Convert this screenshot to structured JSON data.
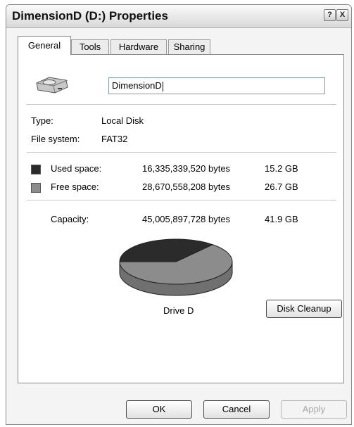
{
  "window": {
    "title": "DimensionD (D:) Properties",
    "help_glyph": "?",
    "close_glyph": "X"
  },
  "tabs": [
    {
      "label": "General",
      "active": true
    },
    {
      "label": "Tools",
      "active": false
    },
    {
      "label": "Hardware",
      "active": false
    },
    {
      "label": "Sharing",
      "active": false
    }
  ],
  "general": {
    "drive_icon": "hard-drive-icon",
    "volume_name": "DimensionD",
    "type_label": "Type:",
    "type_value": "Local Disk",
    "filesystem_label": "File system:",
    "filesystem_value": "FAT32",
    "used": {
      "label": "Used space:",
      "bytes": "16,335,339,520 bytes",
      "size": "15.2 GB",
      "color": "#2b2b2b"
    },
    "free": {
      "label": "Free space:",
      "bytes": "28,670,558,208 bytes",
      "size": "26.7 GB",
      "color": "#8c8c8c"
    },
    "capacity": {
      "label": "Capacity:",
      "bytes": "45,005,897,728 bytes",
      "size": "41.9 GB"
    },
    "drive_label": "Drive D",
    "disk_cleanup_label": "Disk Cleanup"
  },
  "chart_data": {
    "type": "pie",
    "series": [
      {
        "name": "Used space",
        "value": 16335339520
      },
      {
        "name": "Free space",
        "value": 28670558208
      }
    ]
  },
  "buttons": {
    "ok": "OK",
    "cancel": "Cancel",
    "apply": "Apply"
  }
}
